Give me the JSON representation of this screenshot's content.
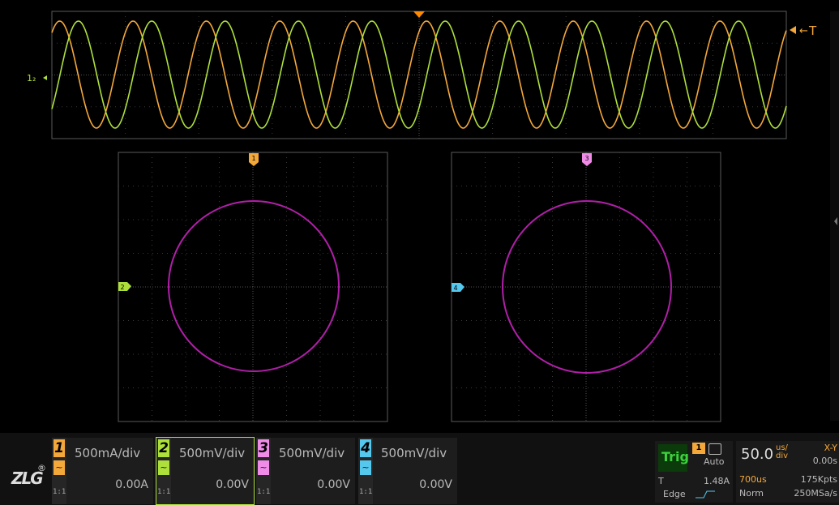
{
  "screen": {
    "trigger_marker_label": "T",
    "overview_left_marker": "1₂",
    "xy1_top_marker": "1",
    "xy1_left_marker": "2",
    "xy2_top_marker": "3",
    "xy2_left_marker": "4"
  },
  "colors": {
    "ch1": "#f4a83a",
    "ch2": "#aee03c",
    "ch3": "#f08ce8",
    "ch4": "#55c8ee",
    "xy_trace": "#b01fa8",
    "grid": "#3a3a3a",
    "trigger": "#ff8a00"
  },
  "channels": [
    {
      "num": "1",
      "scale": "500mA/div",
      "offset": "0.00A",
      "probe": "1:1",
      "color": "#f4a83a",
      "coupling_icon": "ac-wave-icon"
    },
    {
      "num": "2",
      "scale": "500mV/div",
      "offset": "0.00V",
      "probe": "1:1",
      "color": "#aee03c",
      "coupling_icon": "ac-wave-icon"
    },
    {
      "num": "3",
      "scale": "500mV/div",
      "offset": "0.00V",
      "probe": "1:1",
      "color": "#f08ce8",
      "coupling_icon": "ac-wave-icon"
    },
    {
      "num": "4",
      "scale": "500mV/div",
      "offset": "0.00V",
      "probe": "1:1",
      "color": "#55c8ee",
      "coupling_icon": "ac-wave-icon"
    }
  ],
  "trigger": {
    "title": "Trig",
    "source": "1",
    "mode": "Auto",
    "type_short": "T",
    "level": "1.48A",
    "type": "Edge"
  },
  "timebase": {
    "value": "50.0",
    "unit_top": "us/",
    "unit_bottom": "div",
    "mode": "X-Y",
    "delay": "0.00s",
    "span": "700us",
    "memory": "175Kpts",
    "acq_mode": "Norm",
    "sample_rate": "250MSa/s"
  },
  "brand": {
    "logo": "ZLG",
    "reg": "®"
  }
}
